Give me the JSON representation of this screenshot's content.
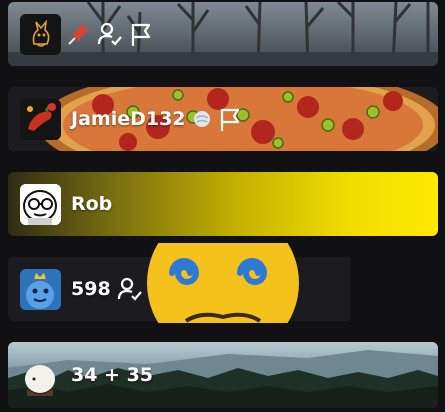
{
  "rows": [
    {
      "name": "",
      "icons": [
        "avatar-fox-icon",
        "pin-icon",
        "user-check-icon",
        "flag-icon"
      ],
      "background": "forest"
    },
    {
      "name": "JamieD132",
      "icons": [
        "avatar-chili-icon",
        "snowball-icon",
        "flag-icon"
      ],
      "background": "pizza"
    },
    {
      "name": "Rob",
      "icons": [
        "avatar-glasses-face-icon"
      ],
      "background": "yellow-gradient",
      "accent": "#ffe900"
    },
    {
      "name": "598",
      "icons": [
        "avatar-crowned-monster-icon",
        "user-check-icon",
        "dizzy-emoji-icon"
      ],
      "background": "dark"
    },
    {
      "name": "34 + 35",
      "icons": [
        "avatar-egg-face-icon"
      ],
      "background": "mountain-forest"
    }
  ],
  "colors": {
    "page_bg": "#111114",
    "row_bg": "#1b1b20",
    "text": "#ffffff",
    "pin": "#e0402f"
  }
}
